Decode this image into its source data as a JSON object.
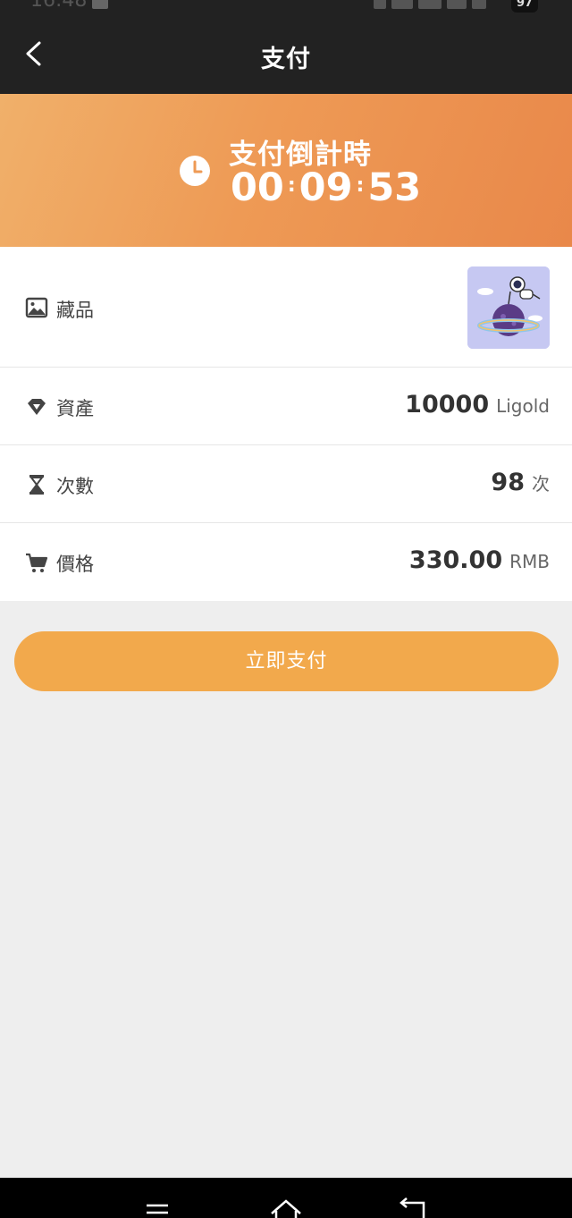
{
  "status_bar": {
    "time": "16:48",
    "battery": "97"
  },
  "header": {
    "title": "支付"
  },
  "countdown": {
    "label": "支付倒計時",
    "hours": "00",
    "minutes": "09",
    "seconds": "53"
  },
  "rows": [
    {
      "label": "藏品"
    },
    {
      "label": "資產",
      "value": "10000",
      "unit": "Ligold"
    },
    {
      "label": "次數",
      "value": "98",
      "unit": "次"
    },
    {
      "label": "價格",
      "value": "330.00",
      "unit": "RMB"
    }
  ],
  "pay_button": {
    "label": "立即支付"
  },
  "colors": {
    "accent": "#f2a94c",
    "header": "#222222",
    "banner_start": "#f0b06a",
    "banner_end": "#e9884a"
  }
}
